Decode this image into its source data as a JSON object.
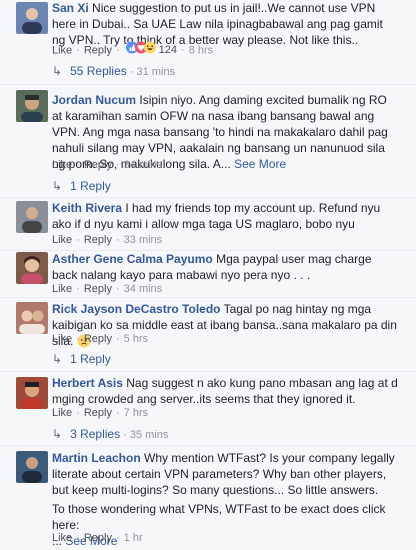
{
  "comments": [
    {
      "name": "San Xi",
      "text": "Nice suggestion to put us in jail!..We cannot use VPN here in Dubai.. Sa UAE Law nila ipinagbabawal ang pag gamit ng VPN.. Try to think of a better way please. Not like this..",
      "like": "Like",
      "reply": "Reply",
      "reaction_count": "124",
      "time": "8 hrs",
      "replies_label": "55 Replies",
      "replies_time": "31 mins",
      "avatar_color": "#6c86b3"
    },
    {
      "name": "Jordan Nucum",
      "text": "Isipin niyo. Ang daming excited bumalik ng RO at karamihan samin OFW na nasa ibang bansang bawal ang VPN. Ang mga nasa bansang 'to hindi na makakalaro dahil pag nahuli silang may VPN, aakalain ng bansang un nanunuod sila ng porn. So, makukulong sila. A...",
      "see_more": "See More",
      "like": "Like",
      "reply": "Reply",
      "time": "34 mins",
      "replies_label": "1 Reply",
      "avatar_color": "#5a6b5a"
    },
    {
      "name": "Keith Rivera",
      "text": "I had my friends top my account up. Refund nyu ako if d nyu kami i allow mga taga US maglaro, bobo nyu",
      "like": "Like",
      "reply": "Reply",
      "time": "33 mins",
      "avatar_color": "#8a8f99"
    },
    {
      "name": "Asther Gene Calma Payumo",
      "text": "Mga paypal user mag charge back nalang kayo para mabawi nyo pera nyo . . .",
      "like": "Like",
      "reply": "Reply",
      "time": "34 mins",
      "avatar_color": "#7d5a4a"
    },
    {
      "name": "Rick Jayson DeCastro Toledo",
      "text": "Tagal po nag hintay ng mga kaibigan ko sa middle east at ibang bansa..sana makalaro pa din sila.",
      "like": "Like",
      "reply": "Reply",
      "time": "5 hrs",
      "replies_label": "1 Reply",
      "avatar_color": "#b07a6a"
    },
    {
      "name": "Herbert Asis",
      "text": "Nag suggest n ako kung pano mbasan ang lag at d mging crowded ang server..its seems that they ignored it.",
      "like": "Like",
      "reply": "Reply",
      "time": "7 hrs",
      "replies_label": "3 Replies",
      "replies_time": "35 mins",
      "avatar_color": "#a04a3a"
    },
    {
      "name": "Martin Leachon",
      "text": "Why mention WTFast? Is your company legally literate about certain VPN parameters? Why ban other players, but keep multi-logins? So many questions... So little answers.",
      "text2": "To those wondering what VPNs, WTFast to be exact does click here:",
      "text3": "...",
      "see_more": "See More",
      "like": "Like",
      "reply": "Reply",
      "time": "1 hr",
      "avatar_color": "#3c5a7a"
    }
  ]
}
